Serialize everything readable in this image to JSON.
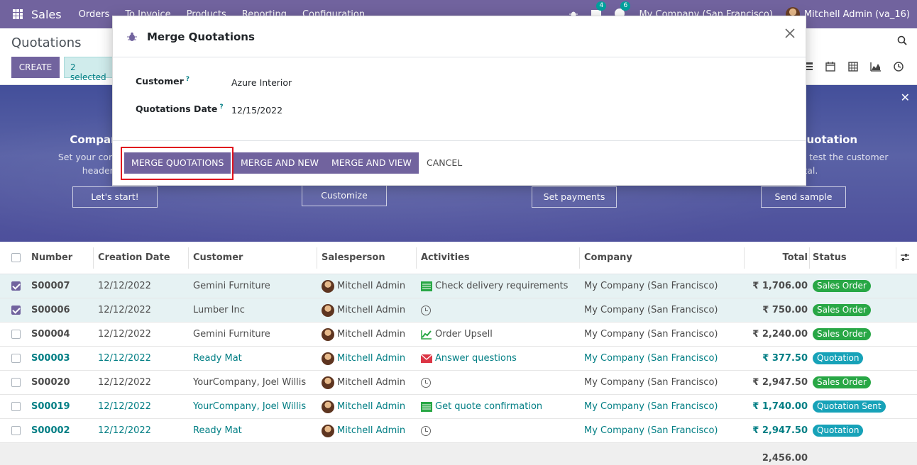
{
  "navbar": {
    "app_name": "Sales",
    "menu": [
      "Orders",
      "To Invoice",
      "Products",
      "Reporting",
      "Configuration"
    ],
    "messages_count": "4",
    "activities_count": "6",
    "company": "My Company (San Francisco)",
    "user": "Mitchell Admin (va_16)"
  },
  "control": {
    "breadcrumb": "Quotations",
    "create_label": "CREATE",
    "selected_label": "2 selected"
  },
  "banner": {
    "steps": [
      {
        "title": "Company Data",
        "text1": "Set your company's data",
        "text2": "header/footer.",
        "button": "Let's start!"
      },
      {
        "title": "",
        "text1": "",
        "text2": "",
        "button": "Customize"
      },
      {
        "title": "",
        "text1": "",
        "text2": "",
        "button": "Set payments"
      },
      {
        "title": "Sample Quotation",
        "text1": "Send a quotation to test the customer",
        "text2": "portal.",
        "button": "Send sample"
      }
    ]
  },
  "table": {
    "headers": {
      "number": "Number",
      "date": "Creation Date",
      "customer": "Customer",
      "salesperson": "Salesperson",
      "activities": "Activities",
      "company": "Company",
      "total": "Total",
      "status": "Status"
    },
    "rows": [
      {
        "number": "S00007",
        "date": "12/12/2022",
        "customer": "Gemini Furniture",
        "salesperson": "Mitchell Admin",
        "activity": "Check delivery requirements",
        "company": "My Company (San Francisco)",
        "total": "₹ 1,706.00",
        "status": "Sales Order"
      },
      {
        "number": "S00006",
        "date": "12/12/2022",
        "customer": "Lumber Inc",
        "salesperson": "Mitchell Admin",
        "activity": "",
        "company": "My Company (San Francisco)",
        "total": "₹ 750.00",
        "status": "Sales Order"
      },
      {
        "number": "S00004",
        "date": "12/12/2022",
        "customer": "Gemini Furniture",
        "salesperson": "Mitchell Admin",
        "activity": "Order Upsell",
        "company": "My Company (San Francisco)",
        "total": "₹ 2,240.00",
        "status": "Sales Order"
      },
      {
        "number": "S00003",
        "date": "12/12/2022",
        "customer": "Ready Mat",
        "salesperson": "Mitchell Admin",
        "activity": "Answer questions",
        "company": "My Company (San Francisco)",
        "total": "₹ 377.50",
        "status": "Quotation"
      },
      {
        "number": "S00020",
        "date": "12/12/2022",
        "customer": "YourCompany, Joel Willis",
        "salesperson": "Mitchell Admin",
        "activity": "",
        "company": "My Company (San Francisco)",
        "total": "₹ 2,947.50",
        "status": "Sales Order"
      },
      {
        "number": "S00019",
        "date": "12/12/2022",
        "customer": "YourCompany, Joel Willis",
        "salesperson": "Mitchell Admin",
        "activity": "Get quote confirmation",
        "company": "My Company (San Francisco)",
        "total": "₹ 1,740.00",
        "status": "Quotation Sent"
      },
      {
        "number": "S00002",
        "date": "12/12/2022",
        "customer": "Ready Mat",
        "salesperson": "Mitchell Admin",
        "activity": "",
        "company": "My Company (San Francisco)",
        "total": "₹ 2,947.50",
        "status": "Quotation"
      }
    ],
    "footer_total": "2,456.00"
  },
  "modal": {
    "title": "Merge Quotations",
    "customer_label": "Customer",
    "customer_value": "Azure Interior",
    "date_label": "Quotations Date",
    "date_value": "12/15/2022",
    "help_mark": "?",
    "buttons": {
      "merge": "MERGE QUOTATIONS",
      "merge_new": "MERGE AND NEW",
      "merge_view": "MERGE AND VIEW",
      "cancel": "CANCEL"
    }
  },
  "colors": {
    "primary": "#71639e",
    "link": "#017e84",
    "sales_order_badge": "#28a745",
    "quotation_badge": "#17a2b8",
    "highlight": "#e0141e"
  }
}
